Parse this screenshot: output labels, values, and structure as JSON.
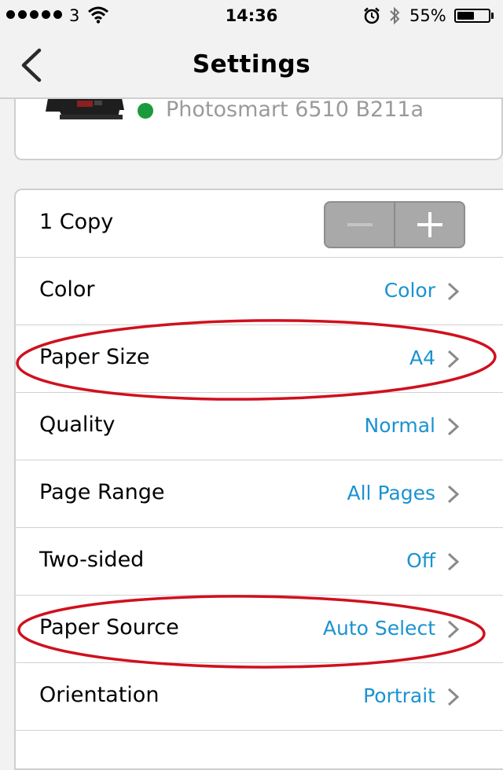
{
  "status_bar": {
    "carrier": "3",
    "time": "14:36",
    "battery_percent": "55%",
    "battery_level": 0.55,
    "icons": [
      "signal-dots-icon",
      "wifi-icon",
      "alarm-icon",
      "bluetooth-icon",
      "battery-icon"
    ]
  },
  "nav": {
    "title": "Settings",
    "back_icon": "chevron-left-icon"
  },
  "printer": {
    "name": "Photosmart 6510 B211a",
    "status_color": "#1a9a3a"
  },
  "settings": {
    "copies_label": "1 Copy",
    "rows": [
      {
        "label": "Color",
        "value": "Color"
      },
      {
        "label": "Paper Size",
        "value": "A4"
      },
      {
        "label": "Quality",
        "value": "Normal"
      },
      {
        "label": "Page Range",
        "value": "All Pages"
      },
      {
        "label": "Two-sided",
        "value": "Off"
      },
      {
        "label": "Paper Source",
        "value": "Auto Select"
      },
      {
        "label": "Orientation",
        "value": "Portrait"
      }
    ]
  },
  "colors": {
    "accent": "#1a93d1",
    "annotation": "#d0101e",
    "background": "#f2f2f2"
  }
}
